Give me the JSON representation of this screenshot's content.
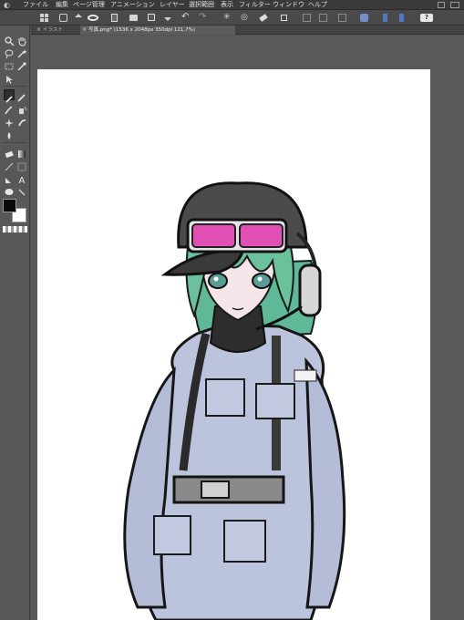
{
  "menu": {
    "items": [
      "ファイル",
      "編集",
      "ページ管理",
      "アニメーション",
      "レイヤー",
      "選択範囲",
      "表示",
      "フィルター",
      "ウィンドウ",
      "ヘルプ"
    ]
  },
  "tabs": [
    {
      "label": "イラスト",
      "active": false
    },
    {
      "label": "写真.png* (1536 x 2048px 350dpi 121.7%)",
      "active": true
    }
  ],
  "colors": {
    "main_color": "#0a0a0a",
    "sub_color": "#ffffff",
    "paper": "#ffffff"
  },
  "canvas": {
    "content": "anime-style character sketch: green-haired girl with black helmet, pink goggles, headset and lavender jumpsuit"
  }
}
